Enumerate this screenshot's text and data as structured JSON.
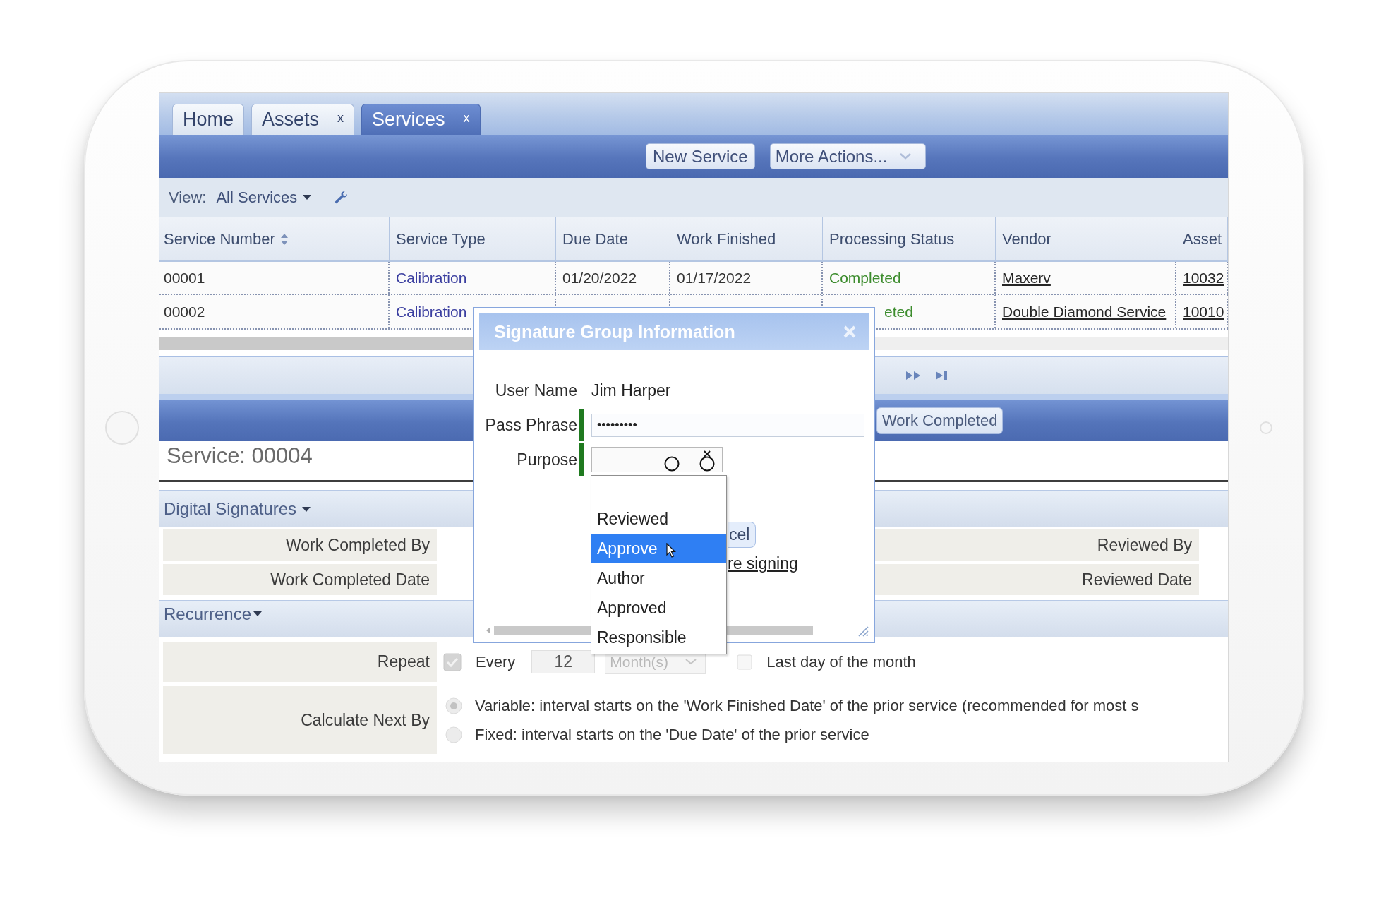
{
  "tabs": [
    {
      "label": "Home",
      "selected": false
    },
    {
      "label": "Assets",
      "close": "x",
      "selected": false
    },
    {
      "label": "Services",
      "close": "x",
      "selected": true
    }
  ],
  "toolbar": {
    "buttons": [
      {
        "label": "New Service",
        "kind": "button"
      },
      {
        "label": "More Actions...",
        "kind": "menu"
      }
    ]
  },
  "view": {
    "label": "View:",
    "value": "All Services"
  },
  "table": {
    "columns": [
      {
        "label": "Service Number",
        "sorted": true
      },
      {
        "label": "Service Type"
      },
      {
        "label": "Due Date"
      },
      {
        "label": "Work Finished"
      },
      {
        "label": "Processing Status"
      },
      {
        "label": "Vendor"
      },
      {
        "label": "Asset"
      }
    ],
    "rows": [
      {
        "cells": [
          {
            "kind": "plain",
            "text": "00001"
          },
          {
            "kind": "type",
            "text": "Calibration"
          },
          {
            "kind": "plain",
            "text": "01/20/2022"
          },
          {
            "kind": "plain",
            "text": "01/17/2022"
          },
          {
            "kind": "status",
            "text": "Completed"
          },
          {
            "kind": "link",
            "text": "Maxerv"
          },
          {
            "kind": "link",
            "text": "10032"
          }
        ]
      },
      {
        "cells": [
          {
            "kind": "plain",
            "text": "00002"
          },
          {
            "kind": "type",
            "text": "Calibration"
          },
          {
            "kind": "covered"
          },
          {
            "kind": "covered"
          },
          {
            "kind": "status",
            "text": "eted",
            "clipped": true
          },
          {
            "kind": "link",
            "text": "Double Diamond Service"
          },
          {
            "kind": "link",
            "text": "10010"
          }
        ]
      }
    ]
  },
  "action_bar": {
    "buttons": [
      {
        "label": "Work Completed"
      }
    ]
  },
  "record": {
    "title": "Service: 00004"
  },
  "digital_signatures": {
    "title": "Digital Signatures",
    "rows": [
      {
        "left_label": "Work Completed By",
        "right_label": "Reviewed By"
      },
      {
        "left_label": "Work Completed Date",
        "right_label": "Reviewed Date"
      }
    ]
  },
  "recurrence": {
    "title": "Recurrence",
    "repeat": {
      "label": "Repeat",
      "checked": true,
      "every": "Every",
      "interval": "12",
      "unit": "Month(s)",
      "last_day": {
        "label": "Last day of the month",
        "checked": false
      }
    },
    "calculate": {
      "label": "Calculate Next By",
      "options": [
        {
          "label": "Variable: interval starts on the 'Work Finished Date' of the prior service (recommended for most s",
          "selected": true
        },
        {
          "label": "Fixed: interval starts on the 'Due Date' of the prior service",
          "selected": false
        }
      ]
    }
  },
  "dialog": {
    "title": "Signature Group Information",
    "fields": [
      {
        "label": "User Name",
        "kind": "static",
        "value": "Jim Harper",
        "required": false
      },
      {
        "label": "Pass Phrase",
        "kind": "password",
        "value": "•••••••••",
        "required": true
      },
      {
        "label": "Purpose",
        "kind": "select",
        "required": true
      }
    ],
    "buttons": [
      {
        "label": "cel"
      }
    ],
    "link": "re signing"
  },
  "dropdown": {
    "options": [
      {
        "label": "Reviewed",
        "selected": false
      },
      {
        "label": "Approve",
        "selected": true
      },
      {
        "label": "Author",
        "selected": false
      },
      {
        "label": "Approved",
        "selected": false
      },
      {
        "label": "Responsible",
        "selected": false
      }
    ]
  }
}
